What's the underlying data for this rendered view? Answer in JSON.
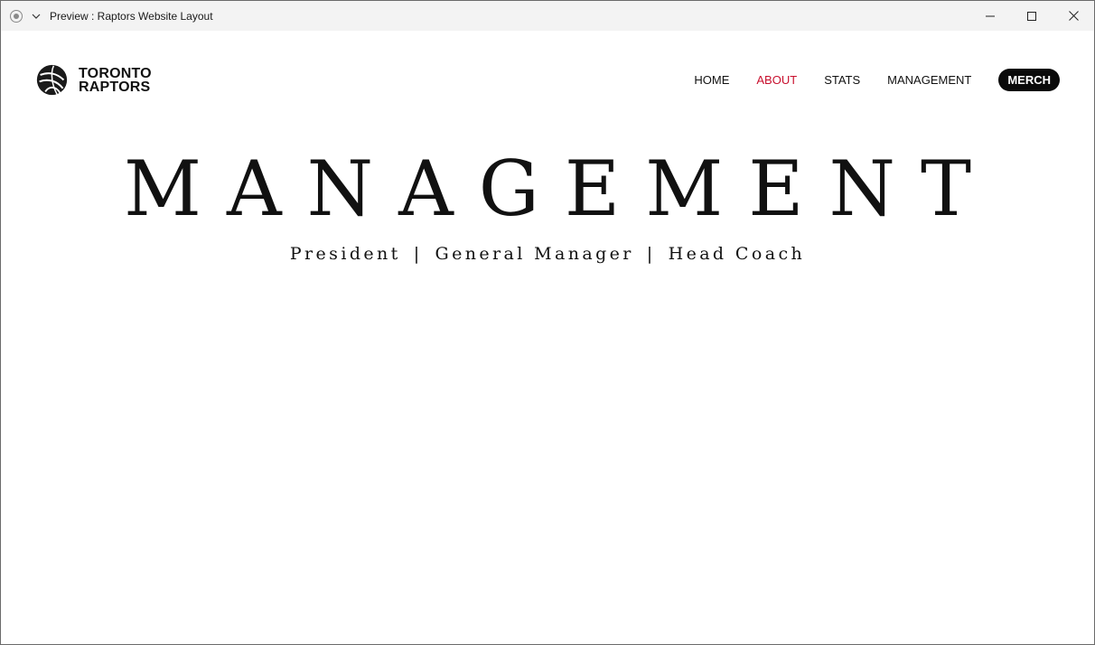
{
  "window": {
    "title": "Preview : Raptors Website Layout",
    "controls": {
      "minimize": "minimize-icon",
      "maximize": "maximize-icon",
      "close": "close-icon"
    }
  },
  "brand": {
    "line1": "TORONTO",
    "line2": "RAPTORS",
    "logo_icon": "raptors-basketball-logo"
  },
  "nav": {
    "items": [
      {
        "label": "HOME",
        "active": false
      },
      {
        "label": "ABOUT",
        "active": true
      },
      {
        "label": "STATS",
        "active": false
      },
      {
        "label": "MANAGEMENT",
        "active": false
      }
    ],
    "merch_label": "MERCH"
  },
  "hero": {
    "title": "MANAGEMENT",
    "subtitle": [
      "President",
      "General Manager",
      "Head Coach"
    ],
    "separator": "|"
  },
  "colors": {
    "accent": "#c8102e",
    "text": "#111111",
    "button_bg": "#0a0a0a",
    "titlebar_bg": "#f3f3f3"
  }
}
